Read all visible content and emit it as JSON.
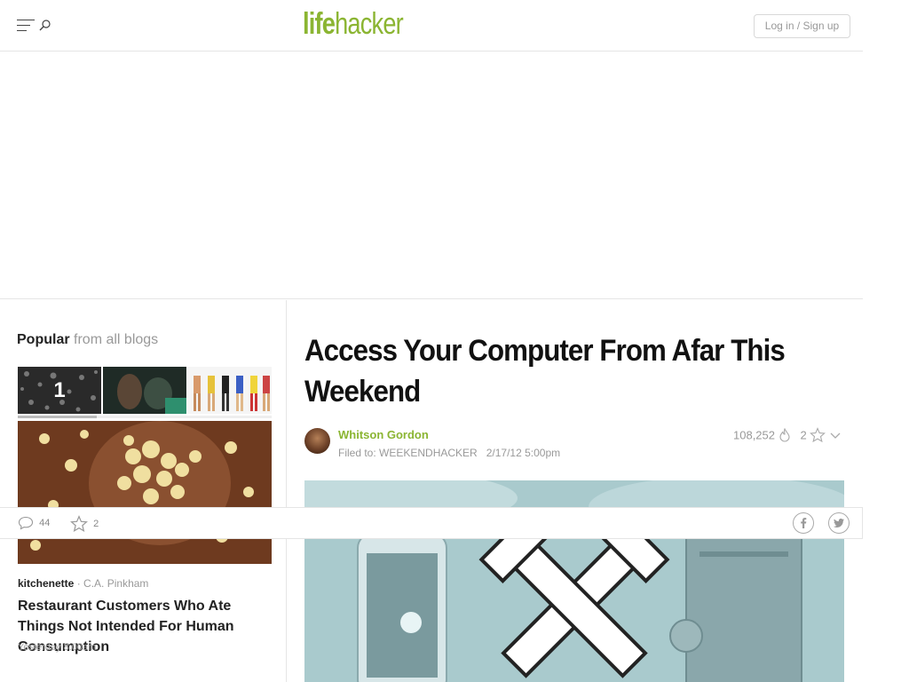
{
  "header": {
    "logo_part1": "life",
    "logo_part2": "hacker",
    "login_label": "Log in / Sign up",
    "menu_icon": "hamburger-menu-icon",
    "search_icon": "search-icon"
  },
  "sidebar": {
    "popular_strong": "Popular",
    "popular_light": "from all blogs",
    "carousel_number": "1",
    "carousel_progress": 0.31,
    "feature": {
      "site": "kitchenette",
      "separator": "·",
      "author": "C.A. Pinkham",
      "headline": "Restaurant Customers Who Ate Things Not Intended For Human Consumption",
      "time": "Yesterday 8:00am"
    }
  },
  "share_bar": {
    "comments_count": "44",
    "stars_count": "2",
    "icons": [
      "comment-icon",
      "star-icon",
      "facebook-icon",
      "twitter-icon"
    ]
  },
  "article": {
    "title": "Access Your Computer From Afar This Weekend",
    "author": "Whitson Gordon",
    "filed_label": "Filed to:",
    "filed_tag": "WEEKENDHACKER",
    "date": "2/17/12 5:00pm",
    "views": "108,252",
    "stars": "2"
  },
  "colors": {
    "brand_green": "#8bb532",
    "muted_text": "#999999",
    "border": "#e5e5e5"
  }
}
